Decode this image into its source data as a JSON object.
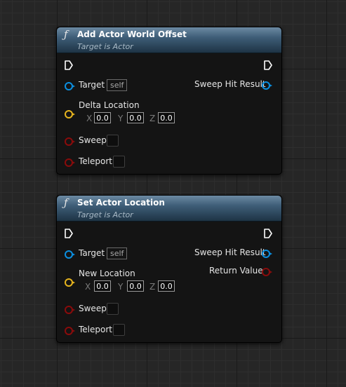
{
  "nodes": [
    {
      "icon": "function-icon",
      "title": "Add Actor World Offset",
      "subtitle": "Target is Actor",
      "target_label": "Target",
      "target_value": "self",
      "location_label": "Delta Location",
      "x_label": "X",
      "x_value": "0.0",
      "y_label": "Y",
      "y_value": "0.0",
      "z_label": "Z",
      "z_value": "0.0",
      "sweep_label": "Sweep",
      "teleport_label": "Teleport",
      "output_sweep_label": "Sweep Hit Result"
    },
    {
      "icon": "function-icon",
      "title": "Set Actor Location",
      "subtitle": "Target is Actor",
      "target_label": "Target",
      "target_value": "self",
      "location_label": "New Location",
      "x_label": "X",
      "x_value": "0.0",
      "y_label": "Y",
      "y_value": "0.0",
      "z_label": "Z",
      "z_value": "0.0",
      "sweep_label": "Sweep",
      "teleport_label": "Teleport",
      "output_sweep_label": "Sweep Hit Result",
      "output_return_label": "Return Value"
    }
  ],
  "colors": {
    "object_pin": "#0b8fe0",
    "vector_pin": "#e6b41e",
    "bool_pin": "#8a0b0b",
    "header": "#3e5d77"
  }
}
